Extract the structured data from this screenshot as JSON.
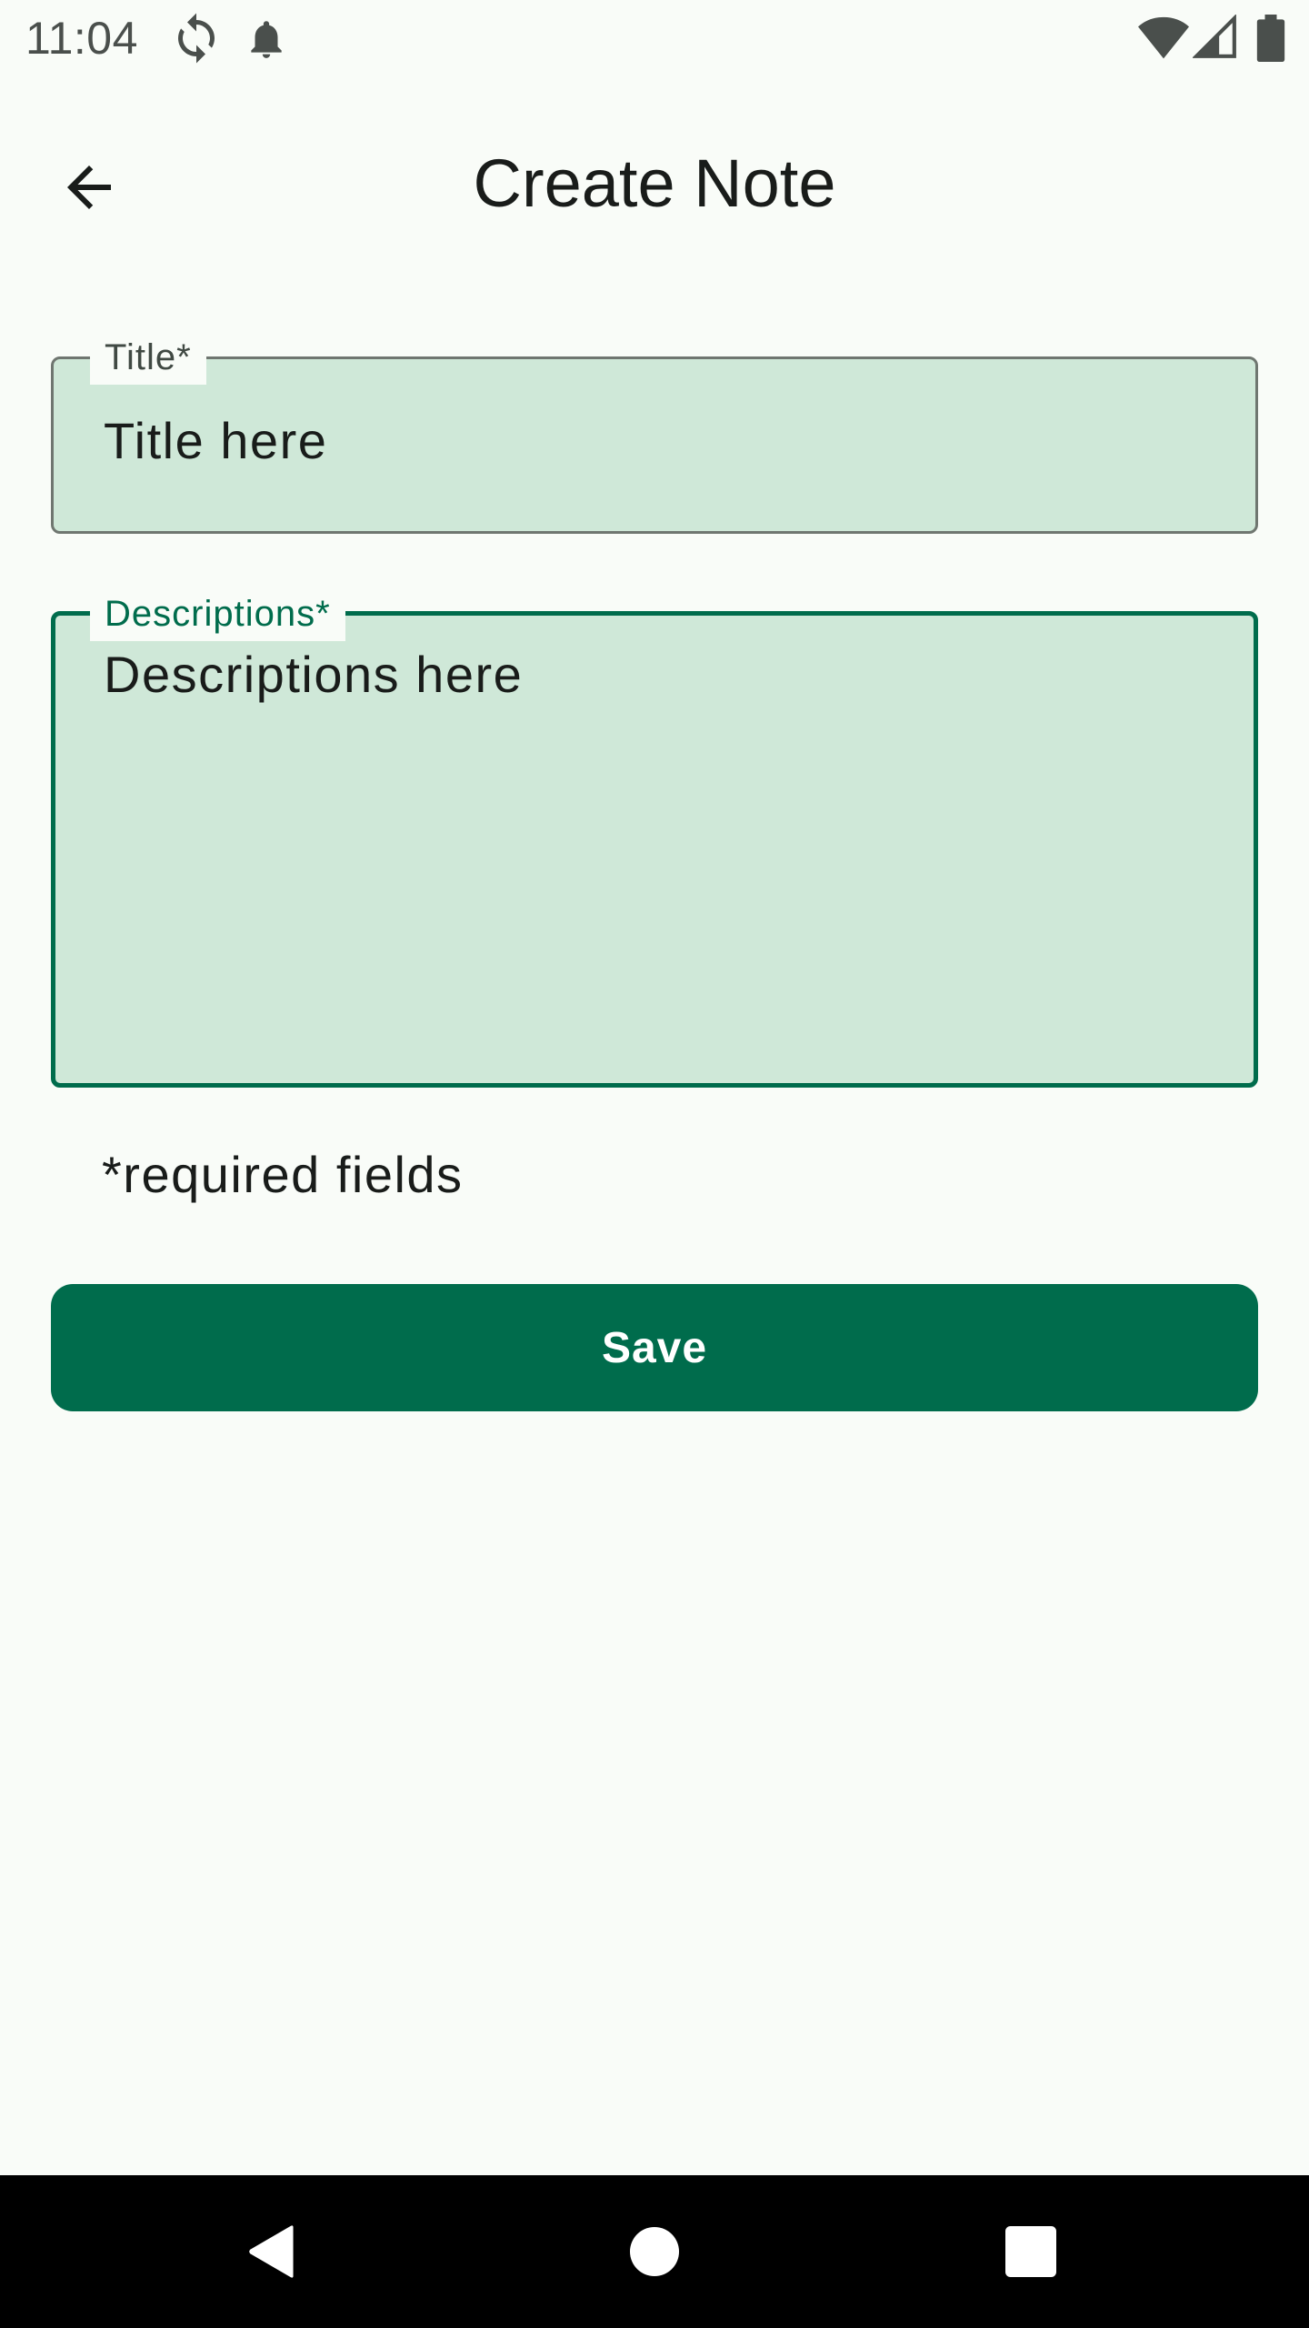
{
  "status_bar": {
    "time": "11:04",
    "icons": [
      "sync-icon",
      "notification-bell-icon",
      "wifi-icon",
      "cellular-signal-icon",
      "battery-icon"
    ]
  },
  "app_bar": {
    "title": "Create Note",
    "back_icon": "arrow-back-icon"
  },
  "form": {
    "title_field": {
      "label": "Title*",
      "value": "Title here"
    },
    "description_field": {
      "label": "Descriptions*",
      "value": "Descriptions here"
    },
    "required_note": "*required fields",
    "save_label": "Save"
  },
  "nav_bar": {
    "icons": [
      "nav-back-icon",
      "nav-home-icon",
      "nav-recents-icon"
    ]
  },
  "colors": {
    "primary": "#006c4c",
    "field_fill": "#cfe8d8",
    "background": "#f9fcf8",
    "outline": "#6f7670",
    "on_surface": "#191c1a"
  }
}
